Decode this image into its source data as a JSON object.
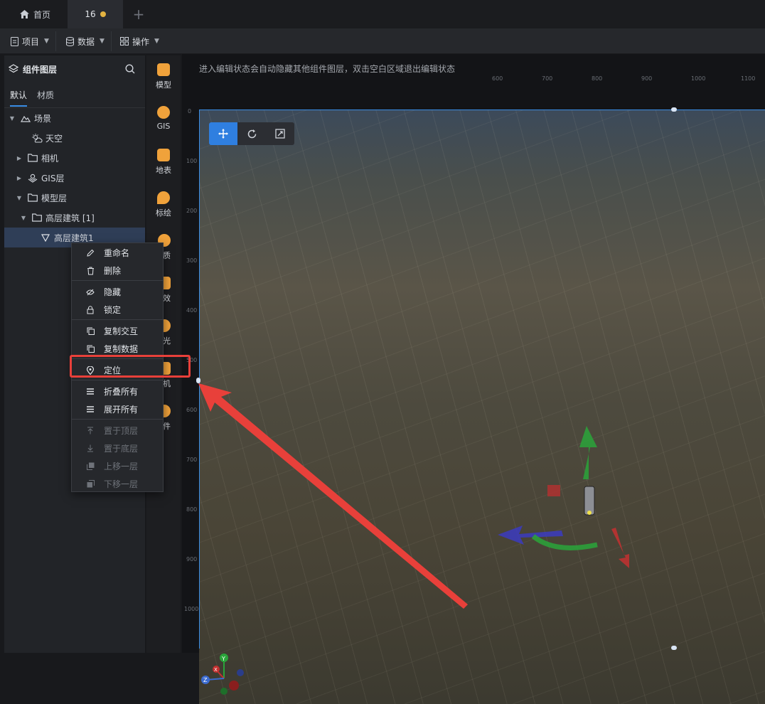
{
  "tabs": {
    "home_label": "首页",
    "file_label": "16",
    "add_label": "+"
  },
  "menubar": {
    "project": "项目",
    "data": "数据",
    "operate": "操作"
  },
  "layers_panel": {
    "title": "组件图层",
    "tab_default": "默认",
    "tab_material": "材质",
    "tree": {
      "scene": "场景",
      "sky": "天空",
      "camera": "相机",
      "gis": "GIS层",
      "model": "模型层",
      "building_group": "高层建筑 [1]",
      "building": "高层建筑1"
    }
  },
  "side_toolbar": {
    "model": "模型",
    "gis": "GIS",
    "terrain": "地表",
    "marker": "标绘",
    "material": "质",
    "effect": "效",
    "light": "光",
    "camera": "机",
    "component": "件"
  },
  "canvas": {
    "hint": "进入编辑状态会自动隐藏其他组件图层，双击空白区域退出编辑状态",
    "ruler_top": [
      "600",
      "700",
      "800",
      "900",
      "1000",
      "1100"
    ],
    "ruler_left": [
      "0",
      "100",
      "200",
      "300",
      "400",
      "500",
      "600",
      "700",
      "800",
      "900",
      "1000"
    ],
    "axis_labels": {
      "y": "Y",
      "x": "X",
      "z": "Z"
    }
  },
  "context_menu": {
    "rename": "重命名",
    "delete": "删除",
    "hide": "隐藏",
    "lock": "锁定",
    "copy_interaction": "复制交互",
    "copy_data": "复制数据",
    "locate": "定位",
    "collapse_all": "折叠所有",
    "expand_all": "展开所有",
    "bring_to_top": "置于顶层",
    "send_to_bottom": "置于底层",
    "move_up": "上移一层",
    "move_down": "下移一层"
  },
  "colors": {
    "accent": "#2f7fe0",
    "highlight_red": "#e8403a",
    "unsaved_dot": "#e3b341",
    "tool_icon": "#f0a23b"
  }
}
